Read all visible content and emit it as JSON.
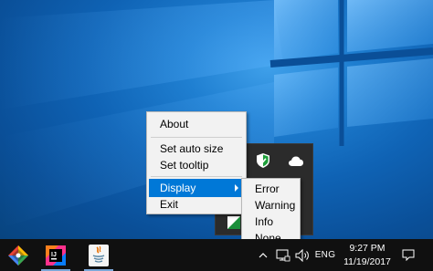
{
  "context_menu": {
    "items": [
      {
        "label": "About"
      },
      {
        "label": "Set auto size"
      },
      {
        "label": "Set tooltip"
      },
      {
        "label": "Display"
      },
      {
        "label": "Exit"
      }
    ],
    "selected": "Display"
  },
  "submenu": {
    "items": [
      {
        "label": "Error"
      },
      {
        "label": "Warning"
      },
      {
        "label": "Info"
      },
      {
        "label": "None"
      }
    ]
  },
  "taskbar": {
    "language": "ENG",
    "time": "9:27 PM",
    "date": "11/19/2017",
    "apps": [
      "colorful-app-icon",
      "jetbrains-ide-icon",
      "java-icon"
    ]
  },
  "tray_popup": {
    "icons": [
      "windows-defender-icon",
      "onedrive-icon",
      "custom-tray-icon"
    ]
  },
  "colors": {
    "selection": "#0078d7",
    "taskbar": "#101010",
    "desktop": "#0a5fae"
  }
}
